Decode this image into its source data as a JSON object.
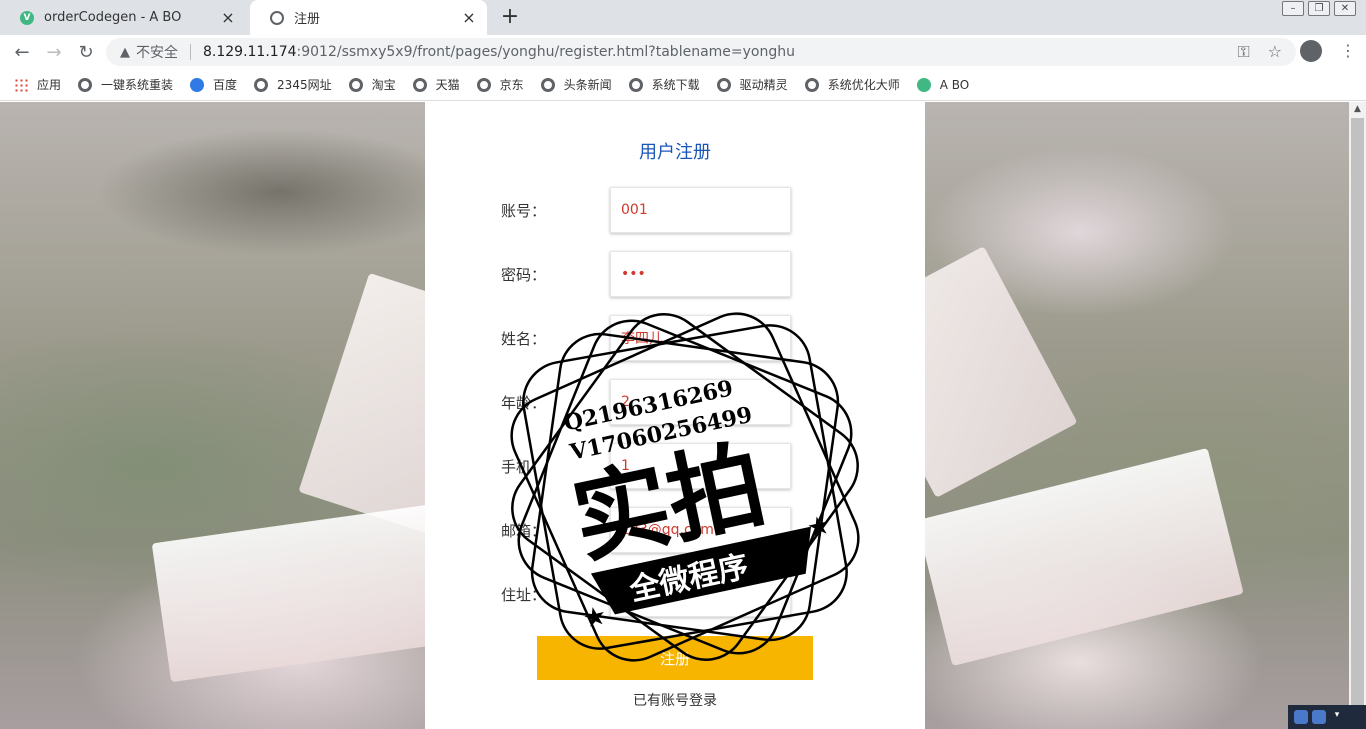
{
  "browser": {
    "tabs": [
      {
        "title": "orderCodegen - A BO",
        "icon": "vue-icon",
        "active": false
      },
      {
        "title": "注册",
        "icon": "globe-icon",
        "active": true
      }
    ],
    "new_tab_label": "+",
    "close_label": "×",
    "address": {
      "warning_label": "不安全",
      "host": "8.129.11.174",
      "path": ":9012/ssmxy5x9/front/pages/yonghu/register.html?tablename=yonghu"
    },
    "bookmarks": [
      {
        "label": "应用",
        "icon": "apps-icon"
      },
      {
        "label": "一键系统重装",
        "icon": "globe-icon"
      },
      {
        "label": "百度",
        "icon": "paw-icon"
      },
      {
        "label": "2345网址",
        "icon": "globe-icon"
      },
      {
        "label": "淘宝",
        "icon": "globe-icon"
      },
      {
        "label": "天猫",
        "icon": "globe-icon"
      },
      {
        "label": "京东",
        "icon": "globe-icon"
      },
      {
        "label": "头条新闻",
        "icon": "globe-icon"
      },
      {
        "label": "系统下载",
        "icon": "globe-icon"
      },
      {
        "label": "驱动精灵",
        "icon": "globe-icon"
      },
      {
        "label": "系统优化大师",
        "icon": "globe-icon"
      },
      {
        "label": "A BO",
        "icon": "vue-icon"
      }
    ]
  },
  "form": {
    "title": "用户注册",
    "fields": [
      {
        "label": "账号：",
        "value": "001",
        "placeholder": "",
        "type": "text"
      },
      {
        "label": "密码：",
        "value": "123",
        "placeholder": "",
        "type": "password"
      },
      {
        "label": "姓名：",
        "value": "李四儿",
        "placeholder": "",
        "type": "text"
      },
      {
        "label": "年龄：",
        "value": "2",
        "placeholder": "",
        "type": "text"
      },
      {
        "label": "手机：",
        "value": "1",
        "placeholder": "",
        "type": "text"
      },
      {
        "label": "邮箱：",
        "value": "123@qq.com",
        "placeholder": "",
        "type": "text"
      },
      {
        "label": "住址：",
        "value": "",
        "placeholder": "请输入住址",
        "type": "text"
      }
    ],
    "submit_label": "注册",
    "login_link": "已有账号登录"
  },
  "watermark": {
    "line1": "Q2196316269",
    "line2": "V17060256499",
    "big_text": "实拍",
    "banner_text": "全微程序"
  },
  "colors": {
    "title": "#1a56b8",
    "submit": "#f7b500",
    "input_text": "#d0392b"
  }
}
